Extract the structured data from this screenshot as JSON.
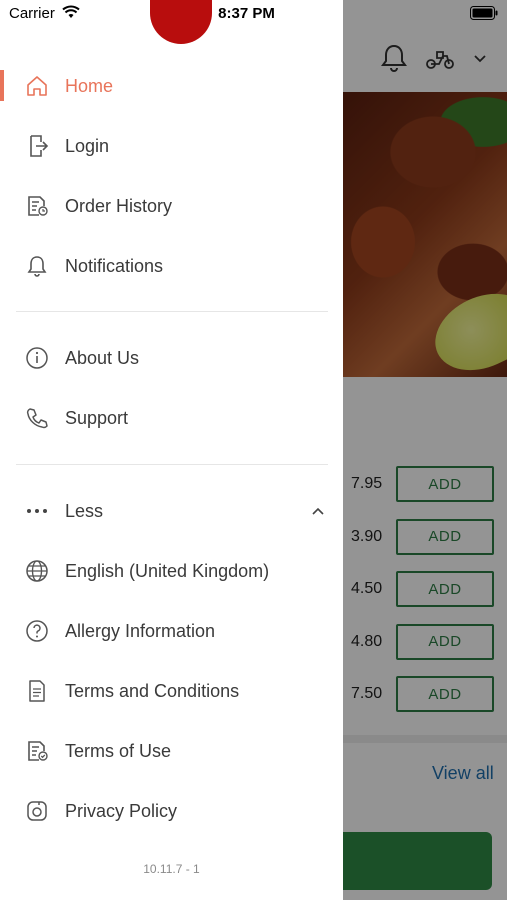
{
  "status_bar": {
    "carrier": "Carrier",
    "time": "8:37 PM"
  },
  "background": {
    "menu_items": [
      {
        "price": "7.95",
        "add_label": "ADD"
      },
      {
        "price": "3.90",
        "add_label": "ADD"
      },
      {
        "price": "4.50",
        "add_label": "ADD"
      },
      {
        "price": "4.80",
        "add_label": "ADD"
      },
      {
        "price": "7.50",
        "add_label": "ADD"
      }
    ],
    "view_all": "View all"
  },
  "drawer": {
    "items": [
      {
        "label": "Home",
        "icon": "home-icon",
        "active": true
      },
      {
        "label": "Login",
        "icon": "login-icon"
      },
      {
        "label": "Order History",
        "icon": "order-history-icon"
      },
      {
        "label": "Notifications",
        "icon": "bell-icon"
      },
      {
        "label": "About Us",
        "icon": "info-icon"
      },
      {
        "label": "Support",
        "icon": "phone-icon"
      },
      {
        "label": "Less",
        "icon": "more-dots-icon"
      },
      {
        "label": "English (United Kingdom)",
        "icon": "globe-icon"
      },
      {
        "label": "Allergy Information",
        "icon": "question-circle-icon"
      },
      {
        "label": "Terms and Conditions",
        "icon": "document-icon"
      },
      {
        "label": "Terms of Use",
        "icon": "document-check-icon"
      },
      {
        "label": "Privacy Policy",
        "icon": "privacy-icon"
      }
    ],
    "version": "10.11.7 - 1"
  },
  "colors": {
    "accent": "#e8745a",
    "brand_red": "#b80d0d",
    "green": "#2e7d45",
    "link_blue": "#1f6fae"
  }
}
